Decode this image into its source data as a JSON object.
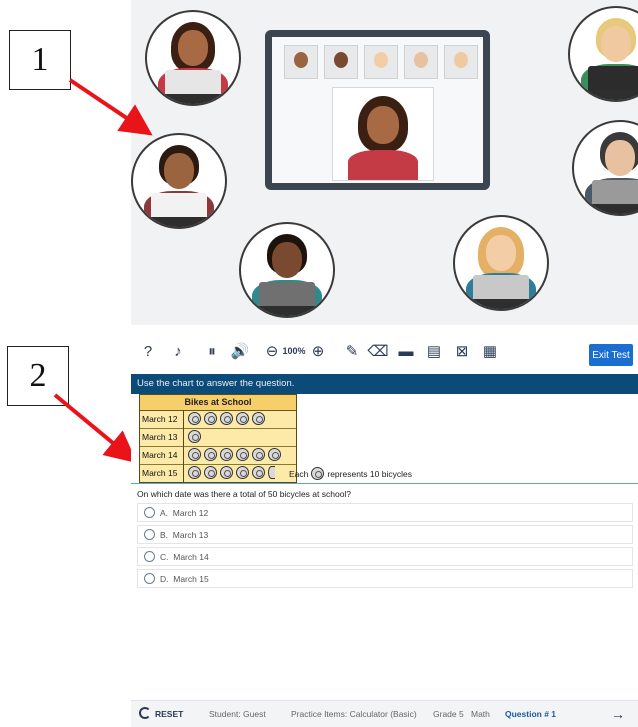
{
  "callouts": {
    "label1": "1",
    "label2": "2"
  },
  "colors": {
    "arrow": "#e8141a",
    "banner": "#0c4b78",
    "accent": "#1b6ed1"
  },
  "test": {
    "toolbar": {
      "icons": [
        "hint-icon",
        "audio-icon",
        "pause-icon",
        "volume-icon",
        "zoom-out-icon",
        "zoom-in-icon",
        "highlighter-icon",
        "eraser-icon",
        "line-reader-icon",
        "notepad-icon",
        "eliminate-icon",
        "calculator-icon"
      ],
      "zoom_label": "100%",
      "exit_label": "Exit Test"
    },
    "instruction": "Use the chart to answer the question.",
    "pictograph": {
      "title": "Bikes at School",
      "rows": [
        {
          "label": "March 12",
          "symbols": 5
        },
        {
          "label": "March 13",
          "symbols": 1
        },
        {
          "label": "March 14",
          "symbols": 6
        },
        {
          "label": "March 15",
          "symbols": 5.5
        }
      ],
      "key_prefix": "Each",
      "key_suffix": "represents 10 bicycles"
    },
    "question": "On which date was there a total of 50 bicycles at school?",
    "options": [
      {
        "letter": "A.",
        "text": "March 12"
      },
      {
        "letter": "B.",
        "text": "March 13"
      },
      {
        "letter": "C.",
        "text": "March 14"
      },
      {
        "letter": "D.",
        "text": "March 15"
      }
    ],
    "footer": {
      "reset": "RESET",
      "student": "Student: Guest",
      "test_name": "Practice Items: Calculator (Basic)",
      "grade": "Grade 5",
      "subject": "Math",
      "question_num": "Question # 1"
    }
  }
}
